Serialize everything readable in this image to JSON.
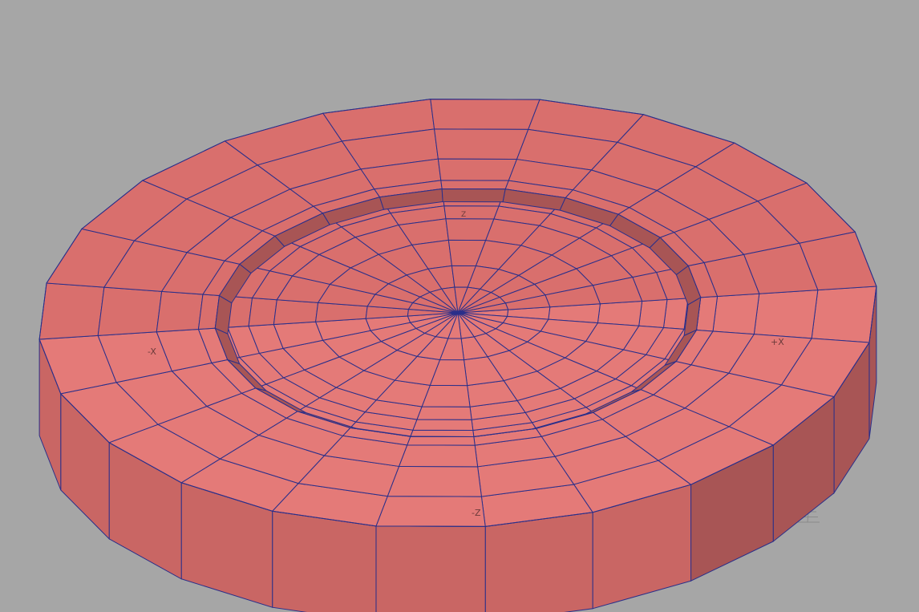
{
  "viewport": {
    "background": "#a6a6a6",
    "axis_labels": {
      "minus_x": "-X",
      "plus_x": "+X",
      "minus_z": "-Z",
      "center_z": "Z"
    }
  },
  "model": {
    "colors": {
      "top_face": "#e47a78",
      "top_face_far": "#d96f6d",
      "side_face": "#c96664",
      "side_face_dark": "#a85555",
      "wire": "#2a2f8a",
      "grid": "#8a8a8a"
    }
  }
}
